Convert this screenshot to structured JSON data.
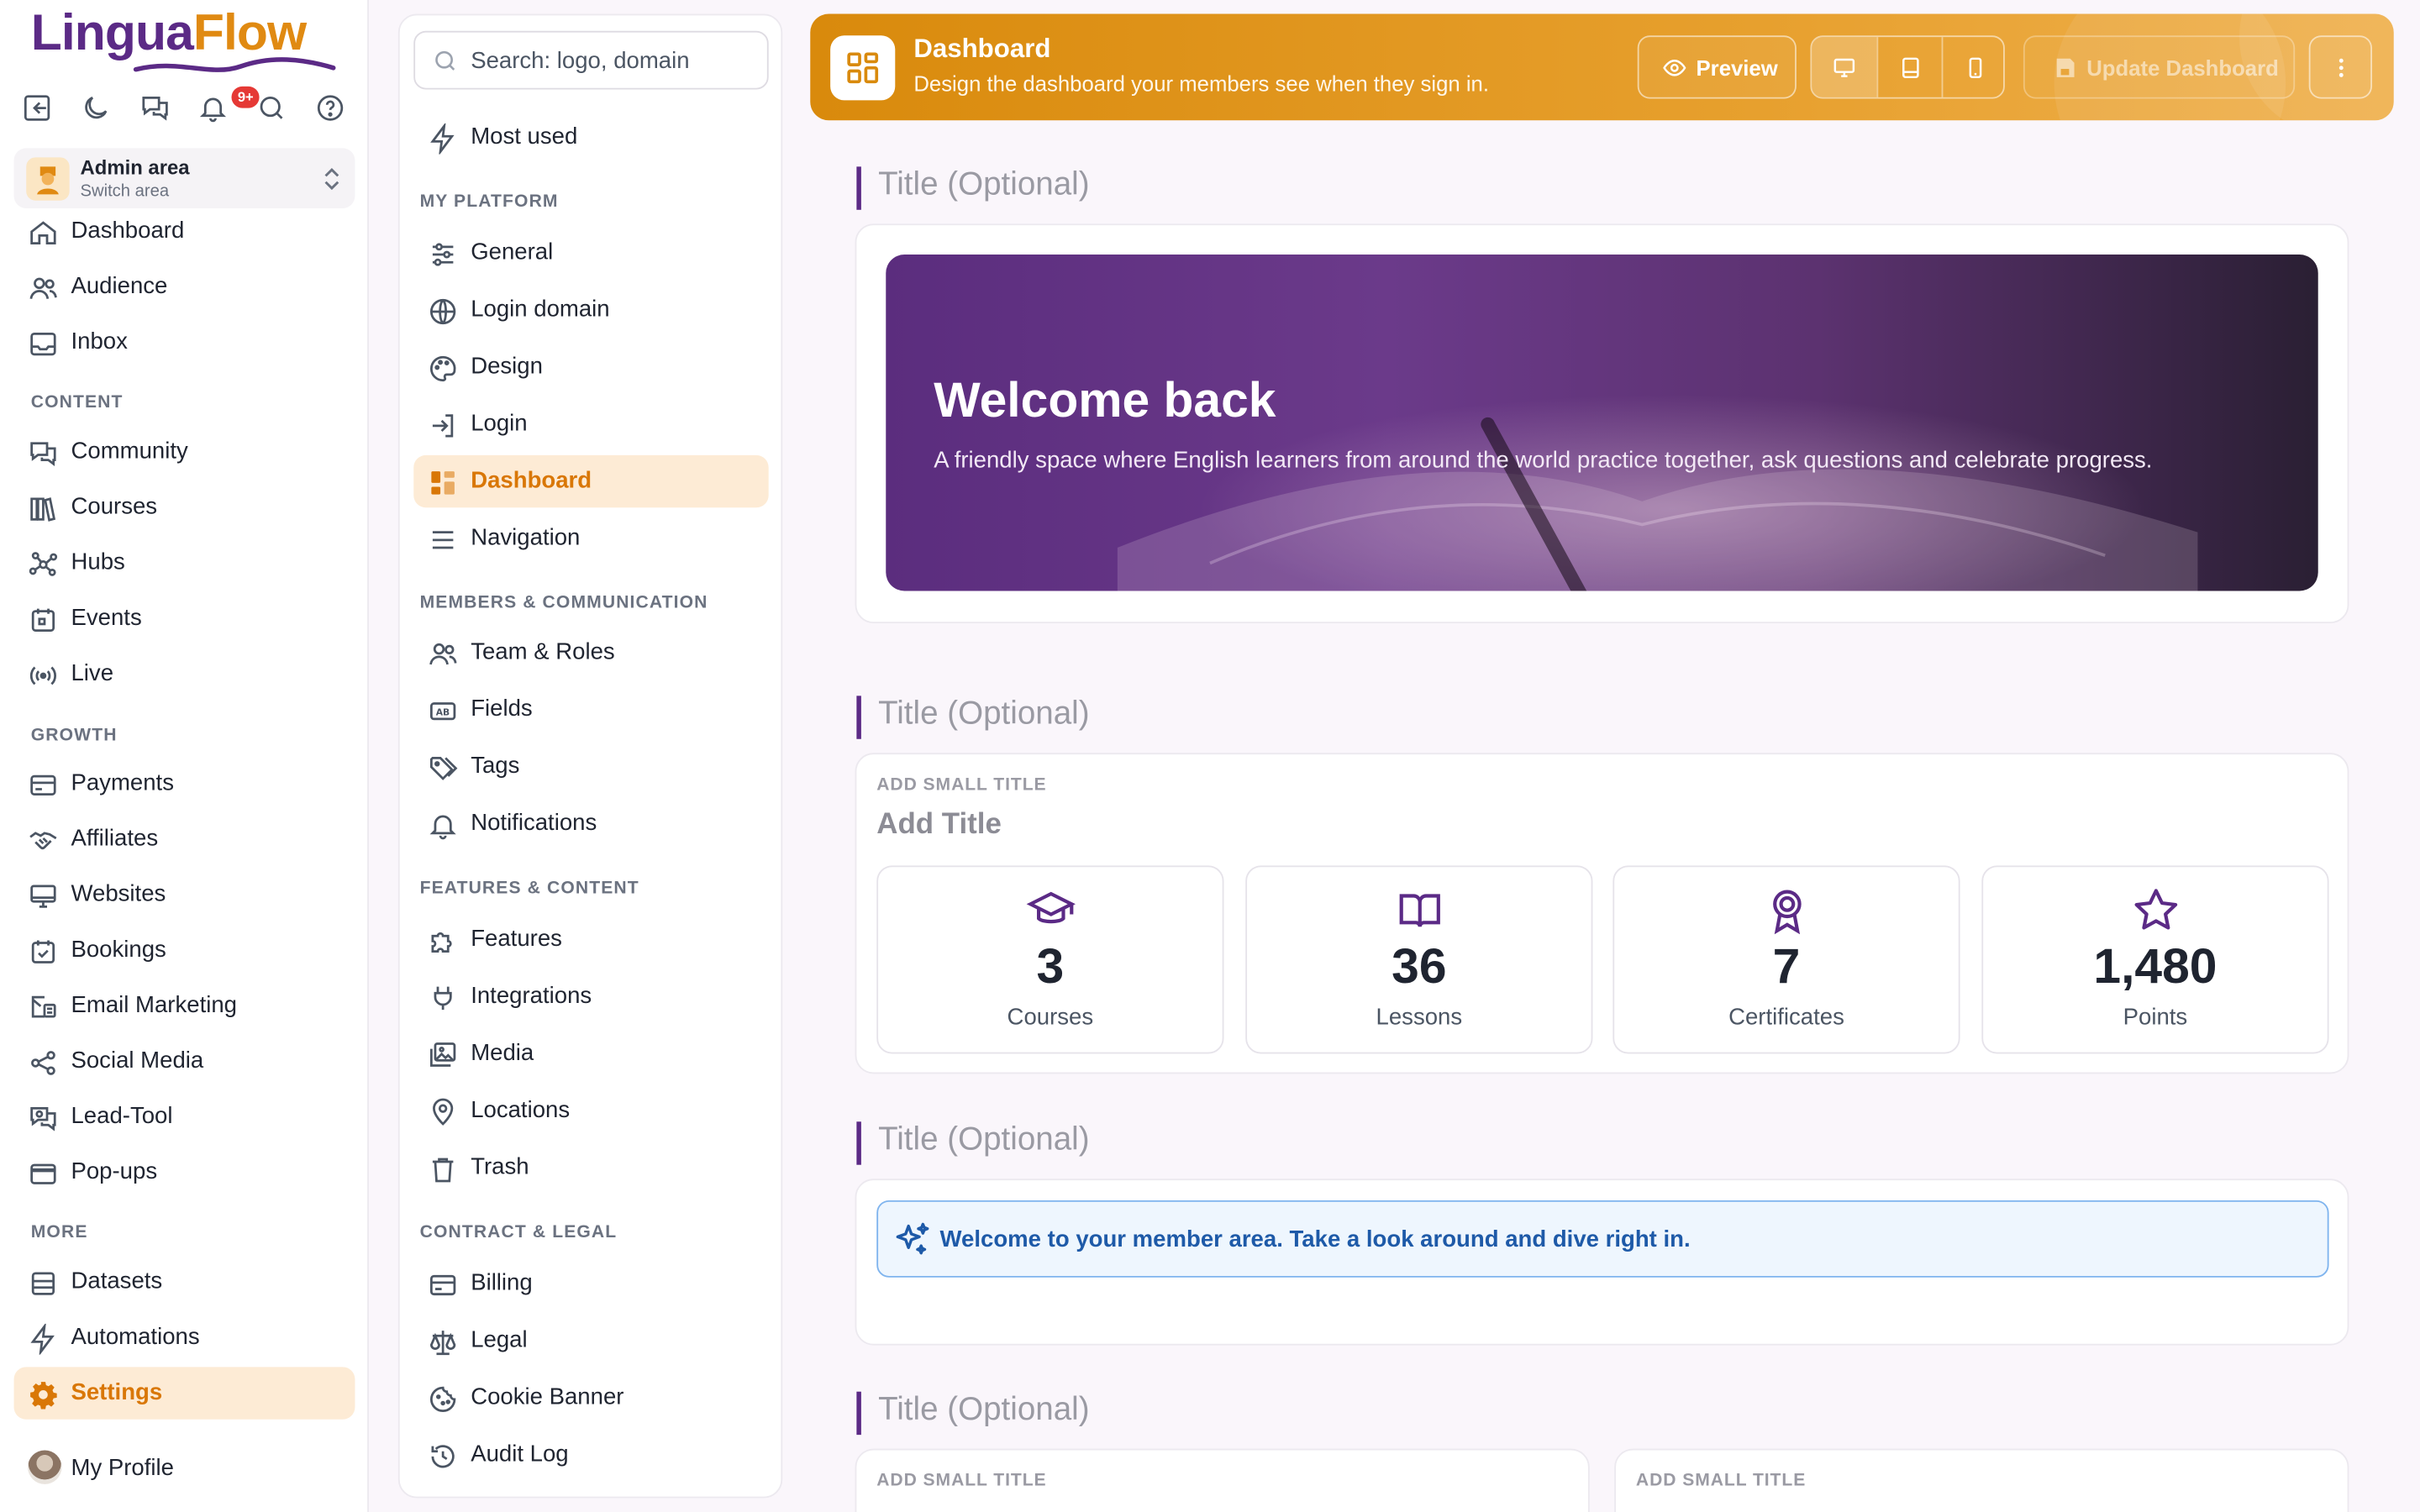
{
  "brand": {
    "part1": "Lingua",
    "part2": "Flow",
    "color_primary": "#5b2a86",
    "color_accent": "#e08a12"
  },
  "top_icons": [
    "exit-icon",
    "moon-icon",
    "chat-icon",
    "bell-icon",
    "search-icon",
    "help-icon"
  ],
  "notifications_badge": "9+",
  "area": {
    "title": "Admin area",
    "subtitle": "Switch area"
  },
  "nav": {
    "main": [
      {
        "label": "Dashboard",
        "icon": "home-icon"
      },
      {
        "label": "Audience",
        "icon": "users-icon"
      },
      {
        "label": "Inbox",
        "icon": "inbox-icon"
      }
    ],
    "content_heading": "CONTENT",
    "content": [
      {
        "label": "Community",
        "icon": "chat-icon"
      },
      {
        "label": "Courses",
        "icon": "books-icon"
      },
      {
        "label": "Hubs",
        "icon": "hub-icon"
      },
      {
        "label": "Events",
        "icon": "calendar-icon"
      },
      {
        "label": "Live",
        "icon": "broadcast-icon"
      }
    ],
    "growth_heading": "GROWTH",
    "growth": [
      {
        "label": "Payments",
        "icon": "card-icon"
      },
      {
        "label": "Affiliates",
        "icon": "handshake-icon"
      },
      {
        "label": "Websites",
        "icon": "monitor-icon"
      },
      {
        "label": "Bookings",
        "icon": "calendar-check-icon"
      },
      {
        "label": "Email Marketing",
        "icon": "mail-icon"
      },
      {
        "label": "Social Media",
        "icon": "share-icon"
      },
      {
        "label": "Lead-Tool",
        "icon": "lead-icon"
      },
      {
        "label": "Pop-ups",
        "icon": "window-icon"
      }
    ],
    "more_heading": "MORE",
    "more": [
      {
        "label": "Datasets",
        "icon": "database-icon"
      },
      {
        "label": "Automations",
        "icon": "bolt-icon"
      },
      {
        "label": "Settings",
        "icon": "gear-icon",
        "active": true
      }
    ],
    "profile": "My Profile"
  },
  "settings": {
    "search_placeholder": "Search: logo, domain",
    "most_used": "Most used",
    "platform_heading": "MY PLATFORM",
    "platform": [
      "General",
      "Login domain",
      "Design",
      "Login",
      "Dashboard",
      "Navigation"
    ],
    "members_heading": "MEMBERS & COMMUNICATION",
    "members": [
      "Team & Roles",
      "Fields",
      "Tags",
      "Notifications"
    ],
    "features_heading": "FEATURES & CONTENT",
    "features": [
      "Features",
      "Integrations",
      "Media",
      "Locations",
      "Trash"
    ],
    "contract_heading": "CONTRACT & LEGAL",
    "contract": [
      "Billing",
      "Legal",
      "Cookie Banner",
      "Audit Log"
    ]
  },
  "topbar": {
    "title": "Dashboard",
    "subtitle": "Design the dashboard your members see when they sign in.",
    "preview": "Preview",
    "update": "Update Dashboard",
    "accent": "#d98a0c"
  },
  "sections": {
    "title_placeholder": "Title (Optional)",
    "hero": {
      "heading": "Welcome back",
      "text": "A friendly space where English learners from around the world practice together, ask questions and celebrate progress."
    },
    "stats_block": {
      "small_title": "ADD SMALL TITLE",
      "title": "Add Title",
      "items": [
        {
          "value": "3",
          "label": "Courses",
          "icon": "graduation-cap-icon"
        },
        {
          "value": "36",
          "label": "Lessons",
          "icon": "open-book-icon"
        },
        {
          "value": "7",
          "label": "Certificates",
          "icon": "award-icon"
        },
        {
          "value": "1,480",
          "label": "Points",
          "icon": "star-icon"
        }
      ]
    },
    "info_text": "Welcome to your member area. Take a look around and dive right in.",
    "bottom_small_title": "ADD SMALL TITLE"
  }
}
